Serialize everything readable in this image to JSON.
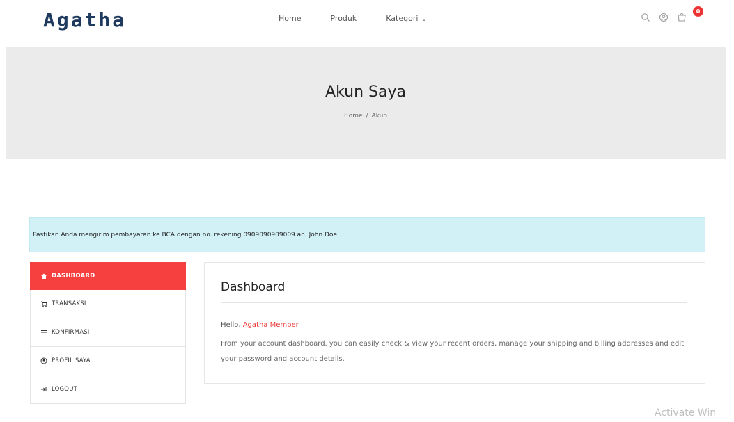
{
  "header": {
    "logo": "Agatha",
    "nav": [
      {
        "label": "Home"
      },
      {
        "label": "Produk"
      },
      {
        "label": "Kategori"
      }
    ],
    "cart_count": "0",
    "icons": [
      "search-icon",
      "user-icon",
      "cart-icon"
    ]
  },
  "banner": {
    "title": "Akun Saya",
    "breadcrumb": [
      "Home",
      "Akun"
    ]
  },
  "alert": {
    "text": "Pastikan Anda mengirim pembayaran ke BCA dengan no. rekening 0909090909009 an. John Doe"
  },
  "sidebar": {
    "items": [
      {
        "label": "DASHBOARD",
        "icon": "home-icon",
        "active": true
      },
      {
        "label": "TRANSAKSI",
        "icon": "cart-icon",
        "active": false
      },
      {
        "label": "KONFIRMASI",
        "icon": "list-icon",
        "active": false
      },
      {
        "label": "PROFIL SAYA",
        "icon": "user-icon",
        "active": false
      },
      {
        "label": "LOGOUT",
        "icon": "logout-icon",
        "active": false
      }
    ]
  },
  "dashboard": {
    "title": "Dashboard",
    "greeting_prefix": "Hello,",
    "user_name": "Agatha Member",
    "description": "From your account dashboard. you can easily check & view your recent orders, manage your shipping and billing addresses and edit your password and account details."
  },
  "watermark": "Activate Win",
  "colors": {
    "accent": "#f5403f",
    "logo": "#1f3a5f",
    "alert_bg": "#d1f1f7",
    "banner_bg": "#ebebeb"
  }
}
